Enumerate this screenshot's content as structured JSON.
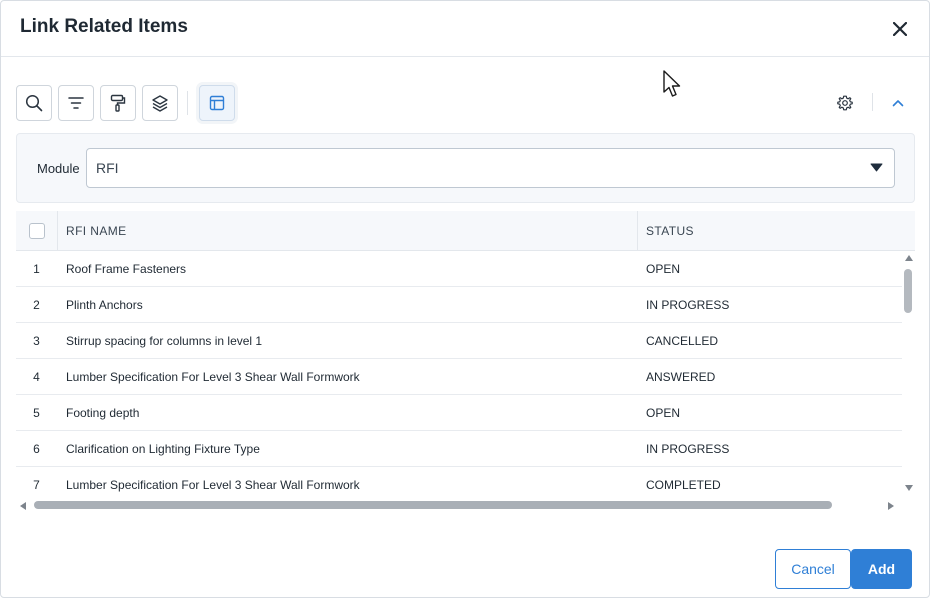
{
  "dialog": {
    "title": "Link Related Items"
  },
  "toolbar": {
    "buttons": [
      {
        "icon": "search-icon"
      },
      {
        "icon": "filter-icon"
      },
      {
        "icon": "paint-roller-icon"
      },
      {
        "icon": "layers-icon"
      },
      {
        "icon": "table-layout-icon",
        "active": true
      }
    ]
  },
  "module": {
    "label": "Module",
    "value": "RFI"
  },
  "grid": {
    "columns": [
      "RFI NAME",
      "STATUS"
    ],
    "rows": [
      {
        "num": "1",
        "name": "Roof Frame Fasteners",
        "status": "OPEN"
      },
      {
        "num": "2",
        "name": "Plinth Anchors",
        "status": "IN PROGRESS"
      },
      {
        "num": "3",
        "name": "Stirrup spacing for columns in level 1",
        "status": "CANCELLED"
      },
      {
        "num": "4",
        "name": "Lumber Specification For Level 3 Shear Wall Formwork",
        "status": "ANSWERED"
      },
      {
        "num": "5",
        "name": "Footing depth",
        "status": "OPEN"
      },
      {
        "num": "6",
        "name": "Clarification on Lighting Fixture Type",
        "status": "IN PROGRESS"
      },
      {
        "num": "7",
        "name": "Lumber Specification For Level 3 Shear Wall Formwork",
        "status": "COMPLETED"
      }
    ]
  },
  "footer": {
    "cancel_label": "Cancel",
    "add_label": "Add"
  },
  "colors": {
    "accent": "#2f7fd6",
    "text": "#1f2933"
  }
}
